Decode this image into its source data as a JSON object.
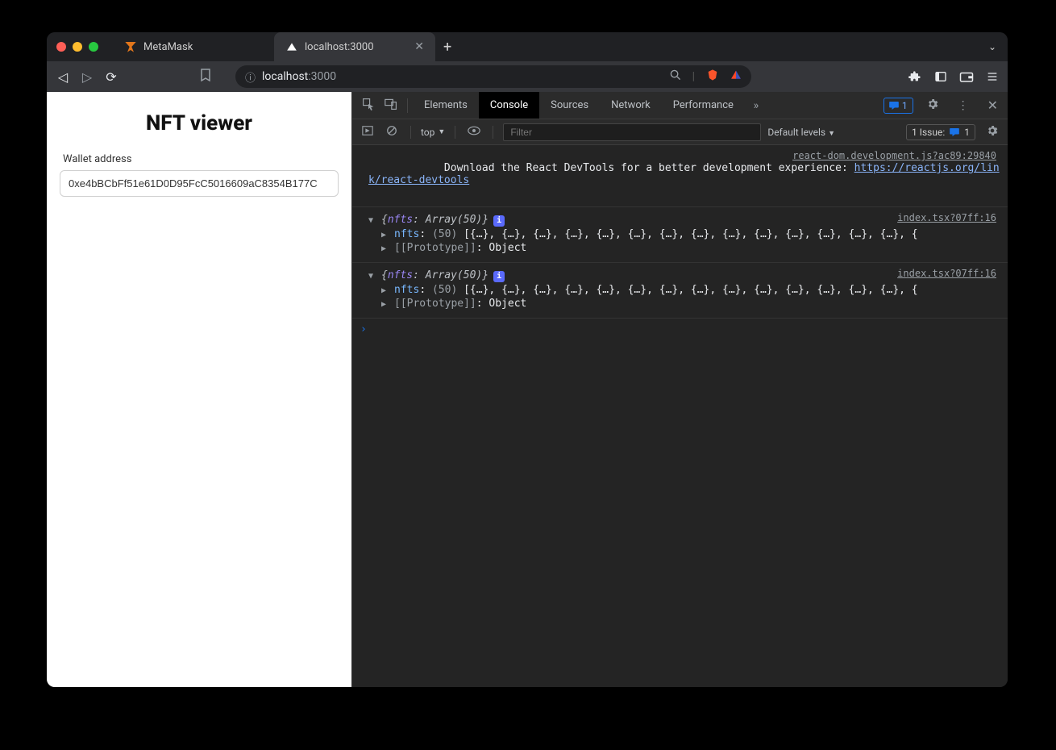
{
  "window": {
    "more_icon": "⌄"
  },
  "tabs": [
    {
      "title": "MetaMask",
      "favicon": "metamask"
    },
    {
      "title": "localhost:3000",
      "favicon": "vercel",
      "active": true
    }
  ],
  "newtab_label": "+",
  "addressbar": {
    "secure_label": "ⓘ",
    "host": "localhost",
    "rest": ":3000",
    "search_icon": "search",
    "brave_icon": "brave",
    "triangle_icon": "triangle"
  },
  "toolbar_right": {
    "extensions": "puzzle",
    "sidepanel": "panel",
    "wallet": "wallet",
    "menu": "menu"
  },
  "page": {
    "title": "NFT viewer",
    "wallet_label": "Wallet address",
    "wallet_value": "0xe4bBCbFf51e61D0D95FcC5016609aC8354B177C"
  },
  "devtools": {
    "tabs": [
      "Elements",
      "Console",
      "Sources",
      "Network",
      "Performance"
    ],
    "active_tab": "Console",
    "more": "»",
    "warn_count": "1",
    "toolbar": {
      "context": "top",
      "filter_placeholder": "Filter",
      "levels": "Default levels",
      "issue_label": "1 Issue:",
      "issue_count": "1"
    },
    "console": {
      "react_source": "react-dom.development.js?ac89:29840",
      "react_msg": "Download the React DevTools for a better development experience: ",
      "react_link": "https://reactjs.org/link/react-devtools",
      "entries": [
        {
          "source": "index.tsx?07ff:16",
          "summary_prefix": "{",
          "summary_key": "nfts",
          "summary_type": "Array(50)",
          "summary_suffix": "}",
          "nfts_key": "nfts",
          "nfts_count": "(50)",
          "nfts_preview": "[{…}, {…}, {…}, {…}, {…}, {…}, {…}, {…}, {…}, {…}, {…}, {…}, {…}, {…}, {",
          "proto_label": "[[Prototype]]",
          "proto_value": "Object"
        },
        {
          "source": "index.tsx?07ff:16",
          "summary_prefix": "{",
          "summary_key": "nfts",
          "summary_type": "Array(50)",
          "summary_suffix": "}",
          "nfts_key": "nfts",
          "nfts_count": "(50)",
          "nfts_preview": "[{…}, {…}, {…}, {…}, {…}, {…}, {…}, {…}, {…}, {…}, {…}, {…}, {…}, {…}, {",
          "proto_label": "[[Prototype]]",
          "proto_value": "Object"
        }
      ]
    }
  }
}
